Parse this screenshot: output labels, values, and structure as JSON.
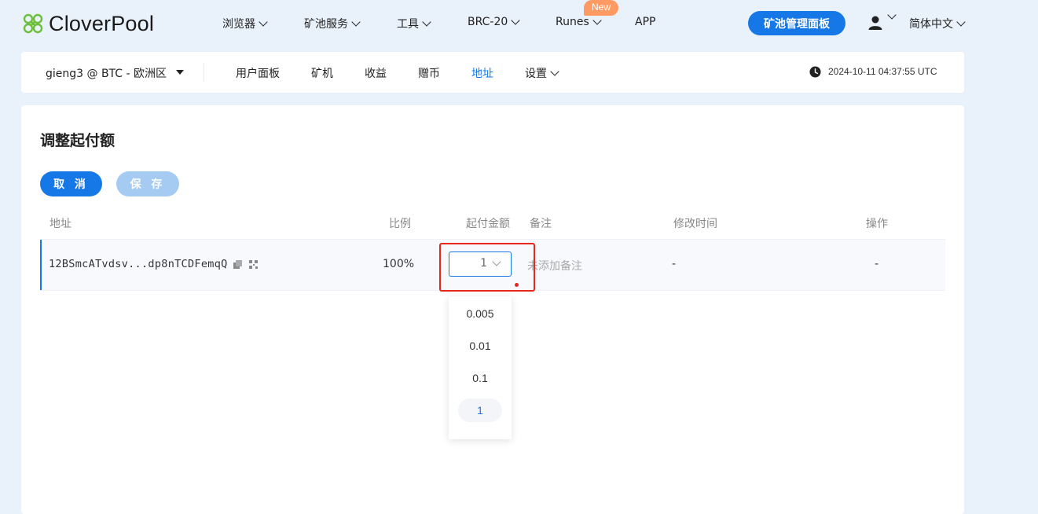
{
  "header": {
    "logo_text": "CloverPool",
    "nav": [
      {
        "label": "浏览器"
      },
      {
        "label": "矿池服务"
      },
      {
        "label": "工具"
      },
      {
        "label": "BRC-20"
      },
      {
        "label": "Runes",
        "badge": "New"
      },
      {
        "label": "APP"
      }
    ],
    "cta_label": "矿池管理面板",
    "language": "简体中文"
  },
  "subnav": {
    "account": "gieng3 @ BTC - 欧洲区",
    "items": [
      "用户面板",
      "矿机",
      "收益",
      "赠币",
      "地址",
      "设置"
    ],
    "active": "地址",
    "datetime": "2024-10-11 04:37:55 UTC"
  },
  "panel": {
    "title": "调整起付额",
    "cancel_label": "取 消",
    "save_label": "保 存",
    "columns": [
      "地址",
      "比例",
      "起付金额",
      "备注",
      "修改时间",
      "操作"
    ],
    "row": {
      "address": "12BSmcATvdsv...dp8nTCDFemqQ",
      "ratio": "100%",
      "threshold": "1",
      "note": "未添加备注",
      "modified": "-",
      "action": "-"
    },
    "dropdown_options": [
      "0.005",
      "0.01",
      "0.1",
      "1"
    ],
    "dropdown_selected": "1"
  },
  "colors": {
    "accent": "#1677e6",
    "highlight": "#e8281a",
    "badge": "#ff9a62",
    "background": "#e9f1fb"
  }
}
